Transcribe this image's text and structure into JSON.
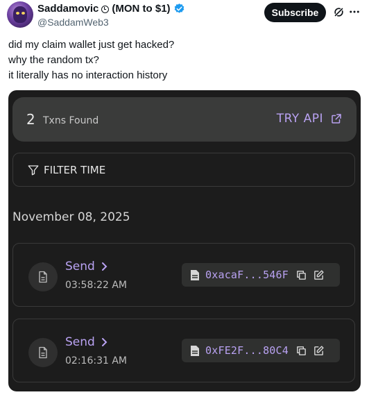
{
  "tweet": {
    "author_name": "Saddamovic",
    "author_name_suffix": "(MON to $1)",
    "handle": "@SaddamWeb3",
    "subscribe_label": "Subscribe",
    "lines": [
      "did my claim wallet just get hacked?",
      "why the random tx?",
      "it literally has no interaction history"
    ]
  },
  "screenshot": {
    "found_count": "2",
    "found_label": "Txns Found",
    "api_label": "TRY API",
    "filter_label": "FILTER TIME",
    "date": "November 08, 2025",
    "transactions": [
      {
        "type": "Send",
        "time": "03:58:22 AM",
        "address": "0xacaF...546F"
      },
      {
        "type": "Send",
        "time": "02:16:31 AM",
        "address": "0xFE2F...80C4"
      }
    ]
  },
  "colors": {
    "accent": "#b9a2f2",
    "card_bg": "#1c1c1c",
    "verified": "#1d9bf0"
  }
}
